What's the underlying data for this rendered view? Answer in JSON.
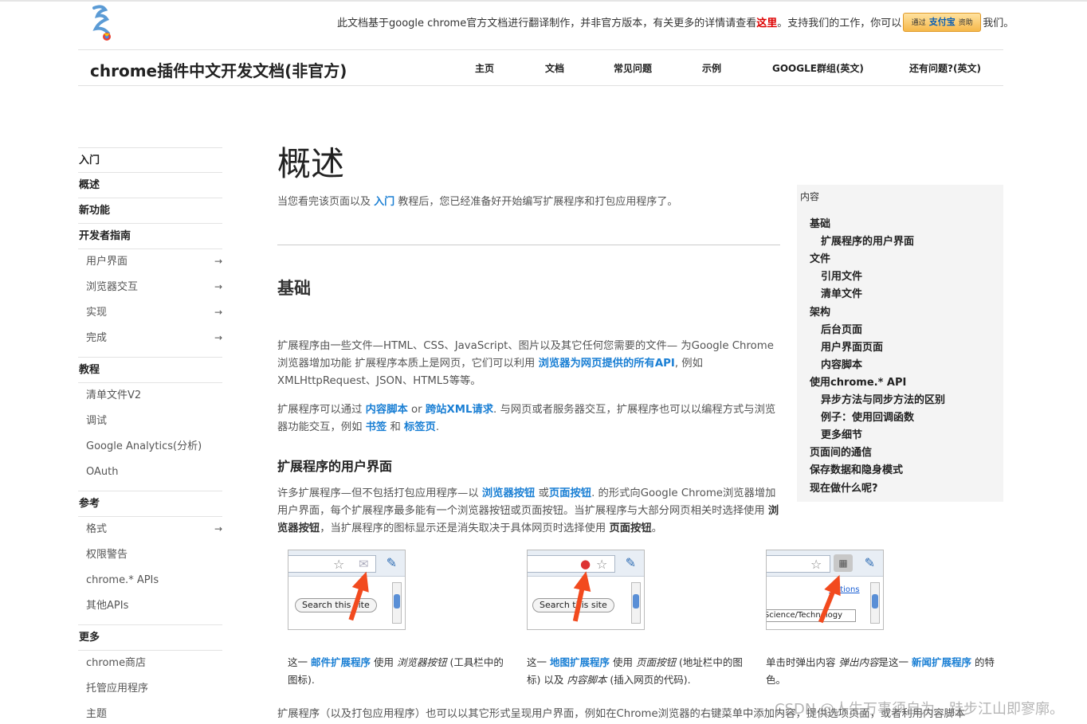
{
  "notice": {
    "text_before": "此文档基于google chrome官方文档进行翻译制作，并非官方版本，有关更多的详情请查看",
    "link": "这里",
    "text_middle": "。支持我们的工作，你可以",
    "button_left": "通过",
    "button_brand": "支付宝",
    "button_right": "资助",
    "text_after": "我们。"
  },
  "site_title": "chrome插件中文开发文档(非官方)",
  "topnav": [
    "主页",
    "文档",
    "常见问题",
    "示例",
    "GOOGLE群组(英文)",
    "还有问题?(英文)"
  ],
  "sidebar": [
    {
      "label": "入门",
      "type": "section"
    },
    {
      "label": "概述",
      "type": "section"
    },
    {
      "label": "新功能",
      "type": "section"
    },
    {
      "label": "开发者指南",
      "type": "section"
    },
    {
      "label": "用户界面",
      "type": "sub",
      "arrow": "→"
    },
    {
      "label": "浏览器交互",
      "type": "sub",
      "arrow": "→"
    },
    {
      "label": "实现",
      "type": "sub",
      "arrow": "→"
    },
    {
      "label": "完成",
      "type": "sub",
      "arrow": "→",
      "last": true
    },
    {
      "label": "教程",
      "type": "section"
    },
    {
      "label": "清单文件V2",
      "type": "sub"
    },
    {
      "label": "调试",
      "type": "sub"
    },
    {
      "label": "Google Analytics(分析)",
      "type": "sub"
    },
    {
      "label": "OAuth",
      "type": "sub",
      "last": true
    },
    {
      "label": "参考",
      "type": "section"
    },
    {
      "label": "格式",
      "type": "sub",
      "arrow": "→"
    },
    {
      "label": "权限警告",
      "type": "sub"
    },
    {
      "label": "chrome.* APIs",
      "type": "sub"
    },
    {
      "label": "其他APIs",
      "type": "sub",
      "last": true
    },
    {
      "label": "更多",
      "type": "section"
    },
    {
      "label": "chrome商店",
      "type": "sub"
    },
    {
      "label": "托管应用程序",
      "type": "sub"
    },
    {
      "label": "主题",
      "type": "sub"
    }
  ],
  "main": {
    "title": "概述",
    "lead_before": "当您看完该页面以及",
    "lead_link": "入门",
    "lead_after": "教程后，您已经准备好开始编写扩展程序和打包应用程序了。",
    "h2_basics": "基础",
    "p1_a": "扩展程序由一些文件—HTML、CSS、JavaScript、图片以及其它任何您需要的文件— 为Google Chrome浏览器增加功能 扩展程序本质上是网页，它们可以利用",
    "p1_link": "浏览器为网页提供的所有API",
    "p1_b": ", 例如 XMLHttpRequest、JSON、HTML5等等。",
    "p2_a": "扩展程序可以通过",
    "p2_link1": "内容脚本",
    "p2_or": "or",
    "p2_link2": "跨站XML请求",
    "p2_b": ". 与网页或者服务器交互，扩展程序也可以以编程方式与浏览器功能交互，例如",
    "p2_link3": "书签",
    "p2_and": "和",
    "p2_link4": "标签页",
    "p2_end": ".",
    "h3_ui": "扩展程序的用户界面",
    "p3_a": "许多扩展程序—但不包括打包应用程序—以",
    "p3_link1": "浏览器按钮",
    "p3_or": "或",
    "p3_link2": "页面按钮",
    "p3_b": ". 的形式向Google Chrome浏览器增加用户界面，每个扩展程序最多能有一个浏览器按钮或页面按钮。当扩展程序与大部分网页相关时选择使用",
    "p3_bold1": "浏览器按钮",
    "p3_c": "，当扩展程序的图标显示还是消失取决于具体网页时选择使用",
    "p3_bold2": "页面按钮",
    "p3_d": "。",
    "shot1_button": "Search this site",
    "shot2_button": "Search this site",
    "shot3_link": "Options",
    "shot3_select": "Science/Technology",
    "cap1_a": "这一",
    "cap1_link": "邮件扩展程序",
    "cap1_b": "使用",
    "cap1_i": "浏览器按钮",
    "cap1_c": "(工具栏中的图标).",
    "cap2_a": "这一",
    "cap2_link": "地图扩展程序",
    "cap2_b": "使用",
    "cap2_i": "页面按钮",
    "cap2_c": "(地址栏中的图标) 以及",
    "cap2_i2": "内容脚本",
    "cap2_d": "(插入网页的代码).",
    "cap3_a": "单击时弹出内容",
    "cap3_i": "弹出内容",
    "cap3_b": "是这一",
    "cap3_link": "新闻扩展程序",
    "cap3_c": "的特色。",
    "bottom": "扩展程序（以及打包应用程序）也可以以其它形式呈现用户界面，例如在Chrome浏览器的右键菜单中添加内容，提供选项页面，或者利用内容脚本"
  },
  "toc": {
    "title": "内容",
    "items": [
      {
        "label": "基础",
        "level": 1
      },
      {
        "label": "扩展程序的用户界面",
        "level": 2
      },
      {
        "label": "文件",
        "level": 1
      },
      {
        "label": "引用文件",
        "level": 2
      },
      {
        "label": "清单文件",
        "level": 2
      },
      {
        "label": "架构",
        "level": 1
      },
      {
        "label": "后台页面",
        "level": 2
      },
      {
        "label": "用户界面页面",
        "level": 2
      },
      {
        "label": "内容脚本",
        "level": 2
      },
      {
        "label": "使用chrome.* API",
        "level": 1
      },
      {
        "label": "异步方法与同步方法的区别",
        "level": 2
      },
      {
        "label": "例子：使用回调函数",
        "level": 2
      },
      {
        "label": "更多细节",
        "level": 2
      },
      {
        "label": "页面间的通信",
        "level": 1
      },
      {
        "label": "保存数据和隐身模式",
        "level": 1
      },
      {
        "label": "现在做什么呢?",
        "level": 1
      }
    ]
  },
  "watermark": "CSDN @人生万事须自为，跬步江山即寥廓。",
  "colors": {
    "link": "#1a7fd4",
    "notice_link": "#dd0000",
    "arrow": "#f24a1e"
  }
}
